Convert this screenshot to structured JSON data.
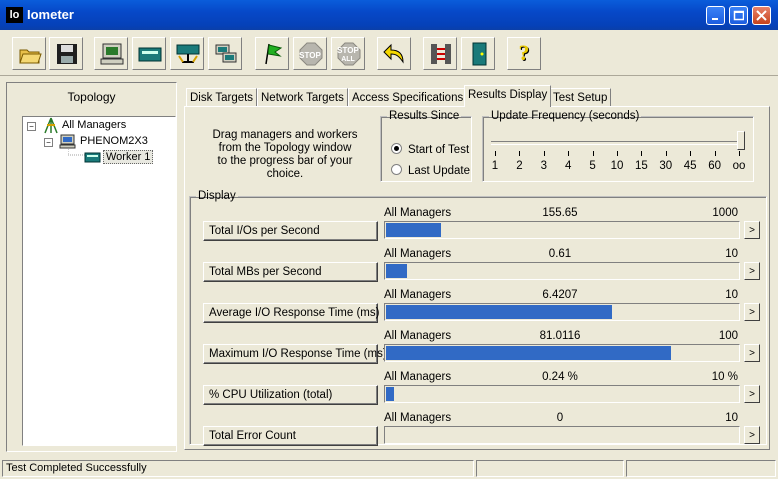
{
  "window": {
    "app_icon_label": "lo",
    "title": "Iometer"
  },
  "toolbar": {
    "buttons": [
      {
        "icon": "open-folder-icon"
      },
      {
        "icon": "save-disk-icon"
      },
      {
        "icon": "new-manager-icon"
      },
      {
        "icon": "disk-worker-icon"
      },
      {
        "icon": "network-worker-icon"
      },
      {
        "icon": "duplicate-worker-icon"
      },
      {
        "icon": "start-flag-icon"
      },
      {
        "icon": "stop-icon",
        "label": "STOP"
      },
      {
        "icon": "stop-all-icon",
        "label": "STOP",
        "sublabel": "ALL"
      },
      {
        "icon": "reset-workers-icon"
      },
      {
        "icon": "disconnect-manager-icon"
      },
      {
        "icon": "exit-door-icon"
      },
      {
        "icon": "help-icon",
        "label": "?"
      }
    ]
  },
  "topology": {
    "title": "Topology",
    "items": [
      {
        "label": "All Managers",
        "toggle": "−"
      },
      {
        "label": "PHENOM2X3",
        "toggle": "−"
      },
      {
        "label": "Worker 1"
      }
    ]
  },
  "tabs": [
    {
      "label": "Disk Targets",
      "active": false
    },
    {
      "label": "Network Targets",
      "active": false
    },
    {
      "label": "Access Specifications",
      "active": false
    },
    {
      "label": "Results Display",
      "active": true
    },
    {
      "label": "Test Setup",
      "active": false
    }
  ],
  "results": {
    "instructions": [
      "Drag managers and workers",
      "from the Topology window",
      "to the progress bar of your choice."
    ],
    "results_since": {
      "legend": "Results Since",
      "options": [
        "Start of Test",
        "Last Update"
      ],
      "selected": "Start of Test"
    },
    "update_frequency": {
      "legend": "Update Frequency (seconds)",
      "ticks": [
        "1",
        "2",
        "3",
        "4",
        "5",
        "10",
        "15",
        "30",
        "45",
        "60",
        "oo"
      ],
      "selected": "oo"
    },
    "display": {
      "legend": "Display",
      "more_label": ">",
      "rows": [
        {
          "button": "Total I/Os per Second",
          "source": "All Managers",
          "value": "155.65",
          "max": "1000",
          "fraction": 0.15565
        },
        {
          "button": "Total MBs per Second",
          "source": "All Managers",
          "value": "0.61",
          "max": "10",
          "fraction": 0.061
        },
        {
          "button": "Average I/O Response Time (ms)",
          "source": "All Managers",
          "value": "6.4207",
          "max": "10",
          "fraction": 0.64207
        },
        {
          "button": "Maximum I/O Response Time (ms)",
          "source": "All Managers",
          "value": "81.0116",
          "max": "100",
          "fraction": 0.810116
        },
        {
          "button": "% CPU Utilization (total)",
          "source": "All Managers",
          "value": "0.24 %",
          "max": "10 %",
          "fraction": 0.024
        },
        {
          "button": "Total Error Count",
          "source": "All Managers",
          "value": "0",
          "max": "10",
          "fraction": 0
        }
      ]
    }
  },
  "status": {
    "message": "Test Completed Successfully"
  },
  "colors": {
    "accent": "#316ac5",
    "titlebar": "#0648c8"
  }
}
